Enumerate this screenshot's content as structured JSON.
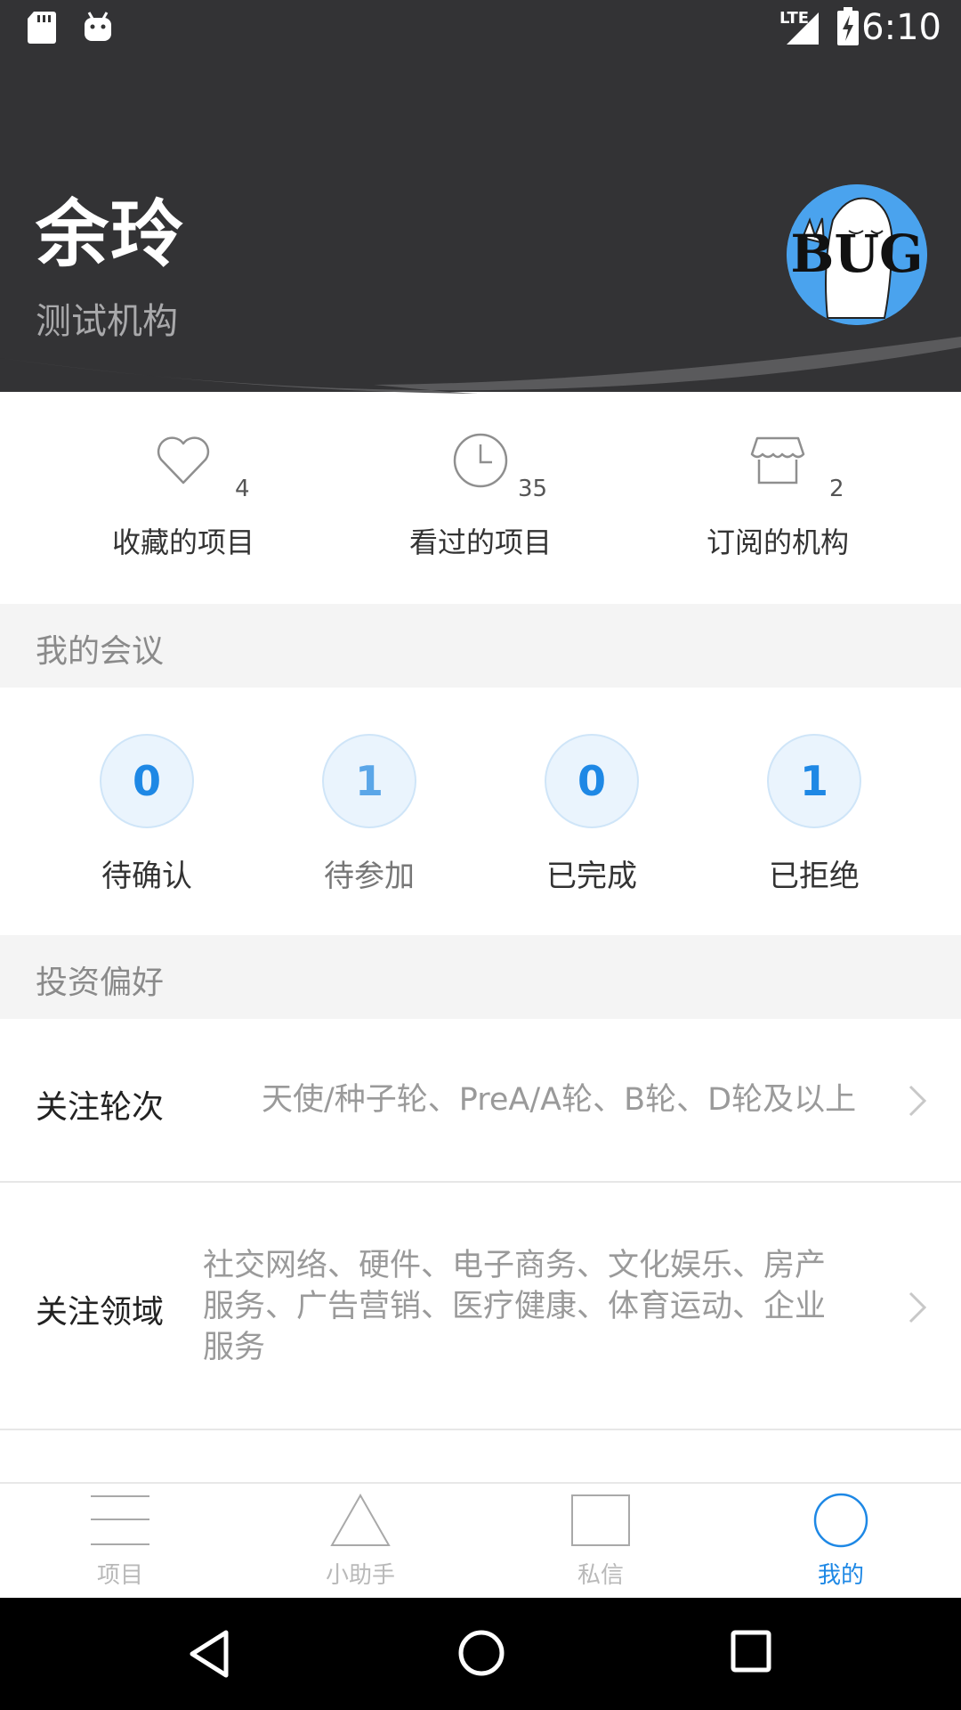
{
  "status_bar": {
    "time": "6:10",
    "network": "LTE",
    "icons": [
      "sd-card-icon",
      "android-icon",
      "signal-icon",
      "battery-charging-icon"
    ]
  },
  "profile": {
    "name": "余玲",
    "organization": "测试机构",
    "avatar_text": "BUG"
  },
  "stats": [
    {
      "label": "收藏的项目",
      "count": "4",
      "icon": "heart-icon"
    },
    {
      "label": "看过的项目",
      "count": "35",
      "icon": "clock-icon"
    },
    {
      "label": "订阅的机构",
      "count": "2",
      "icon": "store-icon"
    }
  ],
  "meetings": {
    "title": "我的会议",
    "items": [
      {
        "label": "待确认",
        "value": "0"
      },
      {
        "label": "待参加",
        "value": "1"
      },
      {
        "label": "已完成",
        "value": "0"
      },
      {
        "label": "已拒绝",
        "value": "1"
      }
    ]
  },
  "preferences": {
    "title": "投资偏好",
    "rounds_label": "关注轮次",
    "rounds_value": "天使/种子轮、PreA/A轮、B轮、D轮及以上",
    "fields_label": "关注领域",
    "fields_value_lines": [
      "社交网络、硬件、电子商务、文化娱乐、房产",
      "服务、广告营销、医疗健康、体育运动、企业",
      "服务"
    ]
  },
  "bottom_nav": [
    {
      "label": "项目",
      "icon": "menu-lines-icon",
      "active": false
    },
    {
      "label": "小助手",
      "icon": "triangle-icon",
      "active": false
    },
    {
      "label": "私信",
      "icon": "square-icon",
      "active": false
    },
    {
      "label": "我的",
      "icon": "circle-icon",
      "active": true
    }
  ],
  "colors": {
    "header_bg": "#333335",
    "accent": "#1e88e5",
    "section_bg": "#f4f4f4"
  }
}
